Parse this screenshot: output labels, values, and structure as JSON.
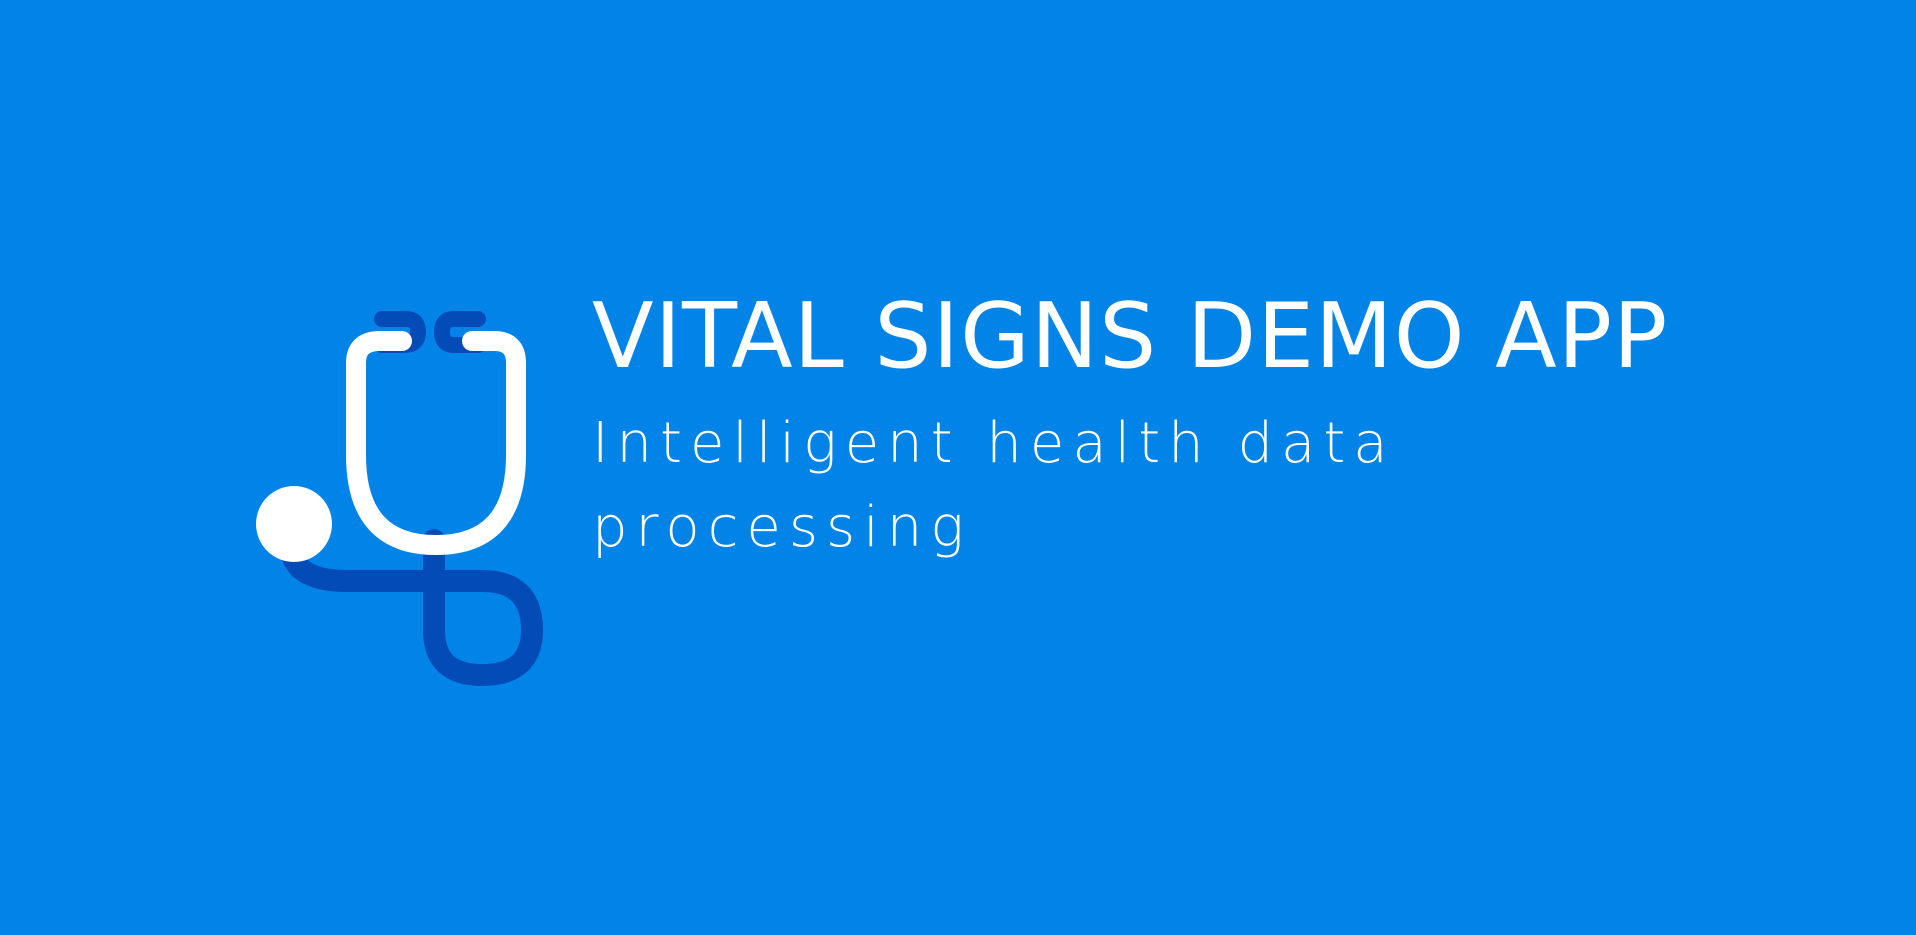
{
  "app": {
    "title": "VITAL SIGNS DEMO APP",
    "tagline": "Intelligent health data processing"
  },
  "logo": {
    "icon": "stethoscope-icon",
    "colors": {
      "primary": "#ffffff",
      "secondary": "#034bb6"
    }
  },
  "theme": {
    "background": "#0283e8",
    "text": "#ffffff"
  }
}
